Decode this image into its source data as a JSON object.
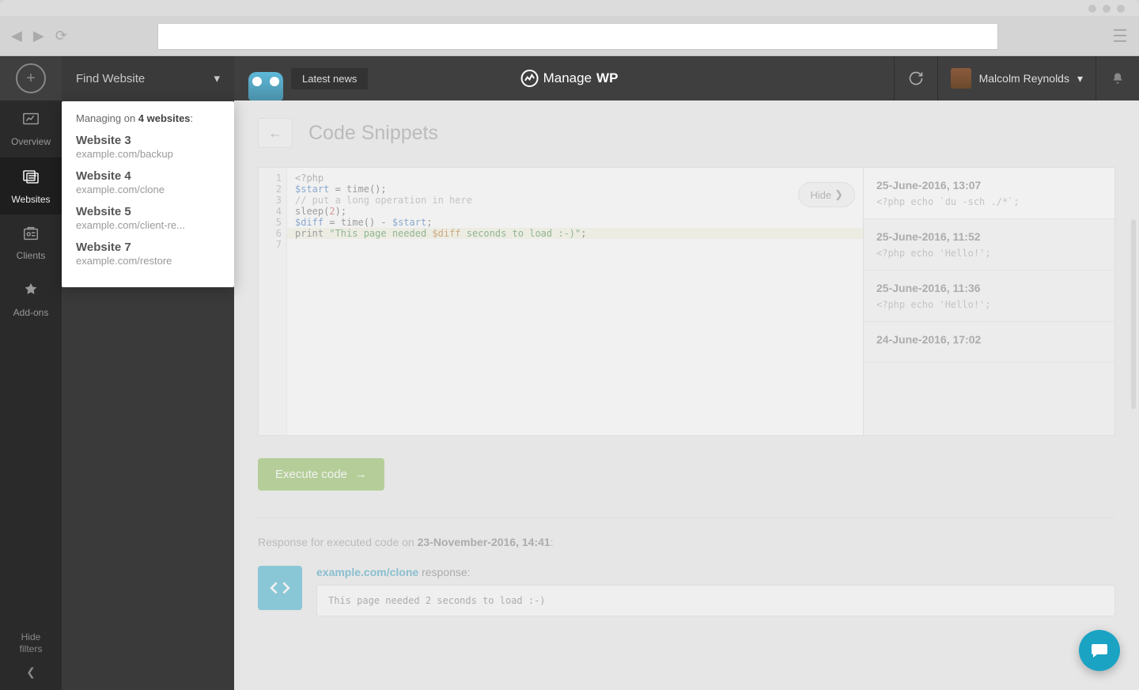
{
  "browser": {
    "navBack": "◀",
    "navFwd": "▶",
    "reload": "⟳",
    "menu": "☰"
  },
  "header": {
    "findWebsite": "Find Website",
    "latestNews": "Latest news",
    "brandPrefix": "Manage",
    "brandSuffix": "WP",
    "userName": "Malcolm Reynolds"
  },
  "sidebar": {
    "overview": "Overview",
    "websites": "Websites",
    "clients": "Clients",
    "addons": "Add-ons",
    "hideFilters1": "Hide",
    "hideFilters2": "filters"
  },
  "dropdown": {
    "prefix": "Managing on ",
    "countLabel": "4 websites",
    "suffix": ":",
    "sites": [
      {
        "name": "Website 3",
        "url": "example.com/backup"
      },
      {
        "name": "Website 4",
        "url": "example.com/clone"
      },
      {
        "name": "Website 5",
        "url": "example.com/client-re..."
      },
      {
        "name": "Website 7",
        "url": "example.com/restore"
      }
    ]
  },
  "page": {
    "title": "Code Snippets",
    "hideLabel": "Hide",
    "executeLabel": "Execute code",
    "code": {
      "l1": "<?php",
      "l2a": "$start",
      "l2b": " = ",
      "l2c": "time",
      "l2d": "();",
      "l3": "// put a long operation in here",
      "l4a": "sleep",
      "l4b": "(",
      "l4c": "2",
      "l4d": ");",
      "l5a": "$diff",
      "l5b": " = ",
      "l5c": "time",
      "l5d": "() - ",
      "l5e": "$start",
      "l5f": ";",
      "l6a": "print ",
      "l6b": "\"This page needed ",
      "l6c": "$diff",
      "l6d": " seconds to load :-)\"",
      "l6e": ";"
    },
    "gutters": [
      "1",
      "2",
      "3",
      "4",
      "5",
      "6",
      "7"
    ],
    "history": [
      {
        "date": "25-June-2016, 13:07",
        "preview": "<?php echo `du -sch ./*`;"
      },
      {
        "date": "25-June-2016, 11:52",
        "preview": "<?php echo 'Hello!';"
      },
      {
        "date": "25-June-2016, 11:36",
        "preview": "<?php echo 'Hello!';"
      },
      {
        "date": "24-June-2016, 17:02",
        "preview": ""
      }
    ],
    "response": {
      "prefix": "Response for executed code on ",
      "timestamp": "23-November-2016, 14:41",
      "suffix": ":",
      "site": "example.com/clone",
      "siteSuffix": " response:",
      "output": "This page needed 2 seconds to load :-)"
    }
  }
}
